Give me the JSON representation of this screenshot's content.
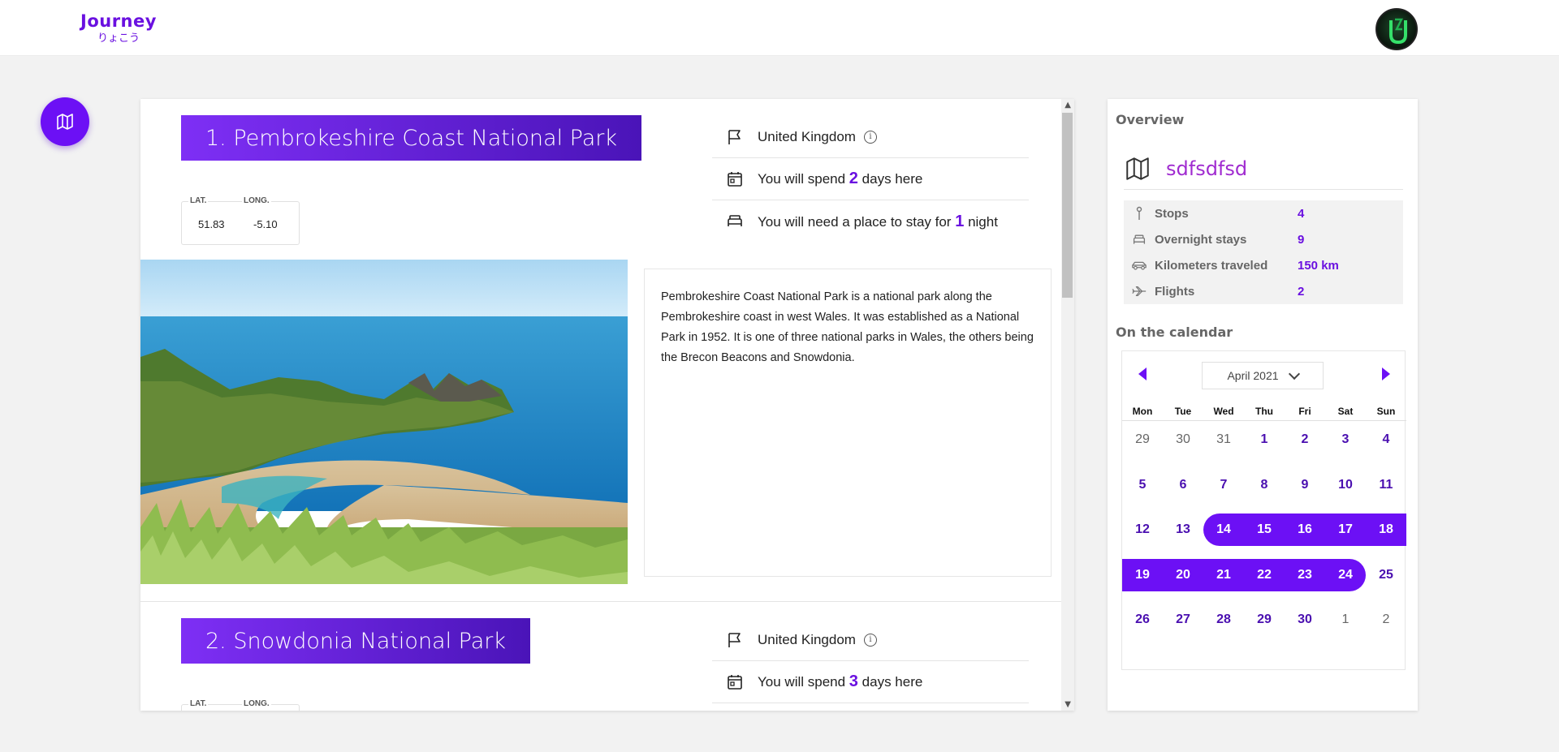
{
  "header": {
    "app_name": "Journey",
    "app_subtitle": "りょこう"
  },
  "colors": {
    "accent": "#6c10f5",
    "accent_dark": "#4a14b8",
    "trip_name": "#a02bd0"
  },
  "stops": [
    {
      "title": "1. Pembrokeshire Coast National Park",
      "lat_label": "LAT.",
      "lat": "51.83",
      "long_label": "LONG.",
      "long": "-5.10",
      "country": "United Kingdom",
      "days_prefix": "You will spend",
      "days": "2",
      "days_suffix": "days here",
      "nights_prefix": "You will need a place to stay for",
      "nights": "1",
      "nights_suffix": "night",
      "description": "Pembrokeshire Coast National Park is a national park along the Pembrokeshire coast in west Wales. It was established as a National Park in 1952. It is one of three national parks in Wales, the others being the Brecon Beacons and Snowdonia."
    },
    {
      "title": "2. Snowdonia National Park",
      "lat_label": "LAT.",
      "long_label": "LONG.",
      "country": "United Kingdom",
      "days_prefix": "You will spend",
      "days": "3",
      "days_suffix": "days here"
    }
  ],
  "sidebar": {
    "overview_title": "Overview",
    "trip_name": "sdfsdfsd",
    "stats": [
      {
        "icon": "pin-icon",
        "label": "Stops",
        "value": "4"
      },
      {
        "icon": "bed-icon",
        "label": "Overnight stays",
        "value": "9"
      },
      {
        "icon": "car-icon",
        "label": "Kilometers traveled",
        "value": "150 km"
      },
      {
        "icon": "plane-icon",
        "label": "Flights",
        "value": "2"
      }
    ],
    "calendar_title": "On the calendar",
    "calendar": {
      "month": "April 2021",
      "weekdays": [
        "Mon",
        "Tue",
        "Wed",
        "Thu",
        "Fri",
        "Sat",
        "Sun"
      ],
      "weeks": [
        [
          "29",
          "30",
          "31",
          "1",
          "2",
          "3",
          "4"
        ],
        [
          "5",
          "6",
          "7",
          "8",
          "9",
          "10",
          "11"
        ],
        [
          "12",
          "13",
          "14",
          "15",
          "16",
          "17",
          "18"
        ],
        [
          "19",
          "20",
          "21",
          "22",
          "23",
          "24",
          "25"
        ],
        [
          "26",
          "27",
          "28",
          "29",
          "30",
          "1",
          "2"
        ]
      ],
      "outside_month": [
        [
          0,
          0
        ],
        [
          0,
          1
        ],
        [
          0,
          2
        ],
        [
          4,
          5
        ],
        [
          4,
          6
        ]
      ],
      "selected_range": {
        "start": "14",
        "end": "24"
      }
    }
  }
}
